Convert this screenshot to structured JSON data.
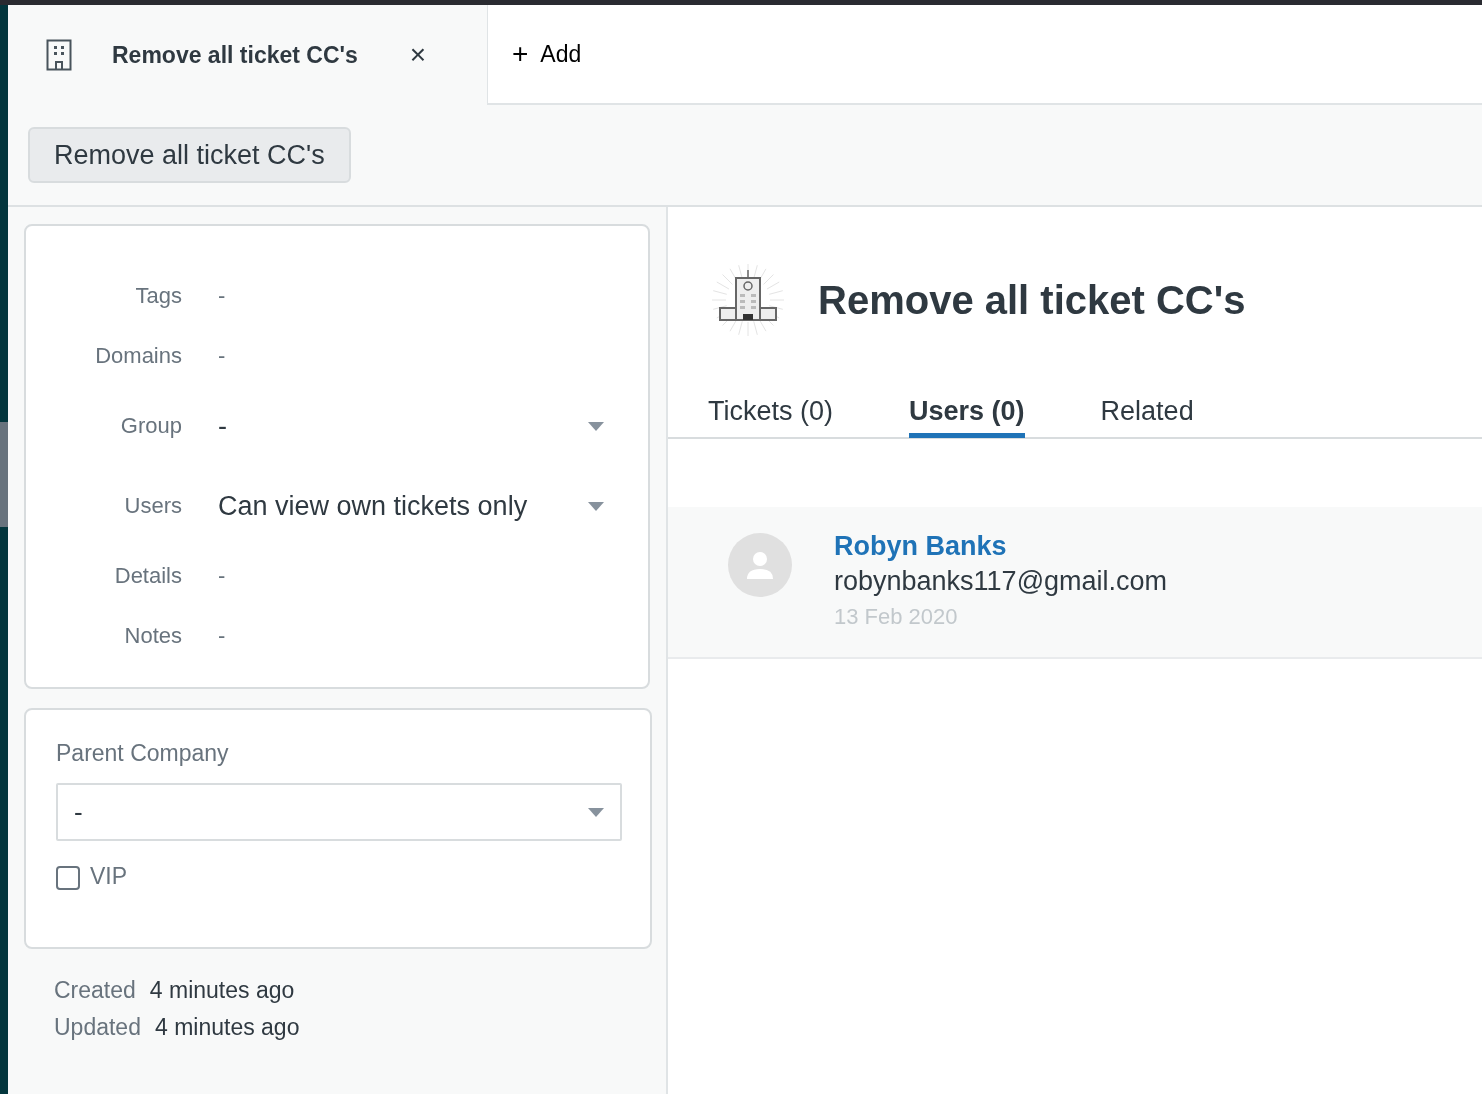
{
  "tab_bar": {
    "tab": {
      "title": "Remove all ticket CC's",
      "close": "×"
    },
    "add": {
      "icon": "+",
      "label": "Add"
    }
  },
  "toolbar": {
    "button": "Remove all ticket CC's"
  },
  "details": {
    "fields": [
      {
        "kind": "text",
        "label": "Tags",
        "placeholder": "-"
      },
      {
        "kind": "text",
        "label": "Domains",
        "placeholder": "-"
      },
      {
        "kind": "dropdown",
        "label": "Group",
        "value": "-"
      },
      {
        "kind": "dropdown",
        "label": "Users",
        "value": "Can view own tickets only"
      },
      {
        "kind": "text",
        "label": "Details",
        "placeholder": "-"
      },
      {
        "kind": "text",
        "label": "Notes",
        "placeholder": "-"
      }
    ]
  },
  "parent_company": {
    "label": "Parent Company",
    "value": "-",
    "vip": {
      "label": "VIP",
      "checked": false
    }
  },
  "timestamps": [
    {
      "label": "Created",
      "value": "4 minutes ago"
    },
    {
      "label": "Updated",
      "value": "4 minutes ago"
    }
  ],
  "organization": {
    "title": "Remove all ticket CC's"
  },
  "tabs": [
    {
      "label": "Tickets (0)",
      "selected": false
    },
    {
      "label": "Users (0)",
      "selected": true
    },
    {
      "label": "Related",
      "selected": false
    }
  ],
  "users": [
    {
      "name": "Robyn Banks",
      "email": "robynbanks117@gmail.com",
      "date": "13 Feb 2020"
    }
  ]
}
